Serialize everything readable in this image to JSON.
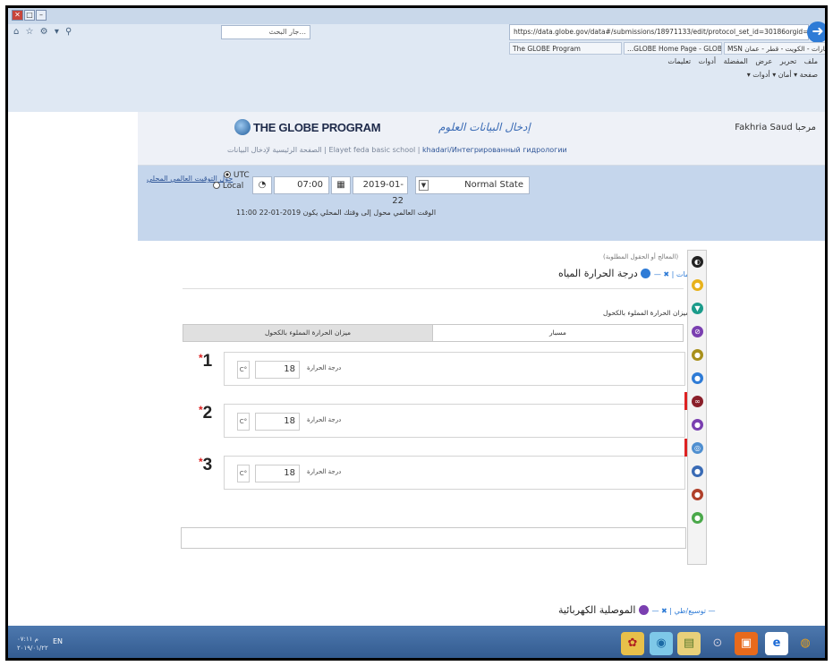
{
  "browser": {
    "search_placeholder": "...جار البحث",
    "address_url": "https://data.globe.gov/data#/submissions/18971133/edit/protocol_set_id=30186orgid=2306394",
    "tabs": [
      {
        "label": "The GLOBE Program"
      },
      {
        "label": "...GLOBE Home Page - GLOBE.g"
      },
      {
        "label": "MSN الإمارات - الكويت - قطر - عمان ..."
      }
    ],
    "menu": {
      "file": "ملف",
      "edit": "تحرير",
      "view": "عرض",
      "favorites": "المفضلة",
      "tools": "أدوات",
      "help": "تعليمات"
    },
    "command_bar": "صفحة ▾   أمان ▾   أدوات ▾"
  },
  "header": {
    "logo": "THE GLOBE PROGRAM",
    "title": "إدخال البيانات العلوم",
    "user": "Fakhria Saud",
    "greeting": "مرحبا",
    "breadcrumb": {
      "home": "الصفحة الرئيسية لإدخال البيانات",
      "school": "Elayet feda basic school",
      "site": "khadari/Интегрированный гидрологии"
    }
  },
  "toolbar": {
    "timezone_link": "حول التوقيت العالمي المحلي",
    "utc_label": "UTC",
    "local_label": "Local",
    "time": "07:00",
    "date": "2019-01-22",
    "state": "Normal State",
    "note": "الوقت العالمي محول إلى وقتك المحلي يكون 2019-01-22 11:00"
  },
  "section1": {
    "hint": "(المعالج أو الحقول المطلوبة)",
    "title": "درجة الحرارة المياه",
    "instrument_label": "ميزان الحرارة المملوء بالكحول",
    "segments": {
      "alcohol": "ميزان الحرارة المملوء بالكحول",
      "probe": "مسبار"
    },
    "rows": [
      {
        "num": "1",
        "unit": "C°",
        "value": "18",
        "label": "درجة الحرارة"
      },
      {
        "num": "2",
        "unit": "C°",
        "value": "18",
        "label": "درجة الحرارة"
      },
      {
        "num": "3",
        "unit": "C°",
        "value": "18",
        "label": "درجة الحرارة"
      }
    ]
  },
  "section2": {
    "title": "الموصلية الكهربائية"
  },
  "taskbar": {
    "lang": "EN",
    "time": "م ۰۷:۱۱",
    "date": "۲۰۱۹/۰۱/۲۲"
  }
}
